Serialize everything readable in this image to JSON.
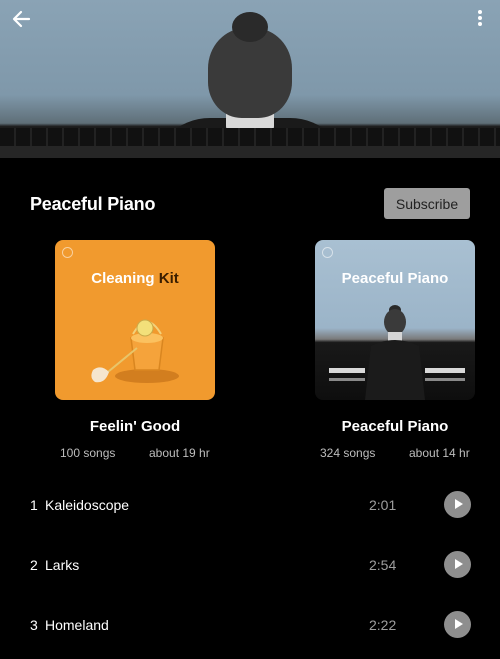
{
  "playlist": {
    "title": "Peaceful Piano",
    "subscribe_label": "Subscribe"
  },
  "icons": {
    "back": "back-arrow-icon",
    "more": "more-vertical-icon",
    "play": "play-icon",
    "spotify": "spotify-logo-icon"
  },
  "cards": [
    {
      "art_title_main": "Cleaning ",
      "art_title_bold": "Kit",
      "name": "Feelin' Good",
      "songs": "100 songs",
      "duration": "about 19 hr",
      "art_color": "#f19a2e"
    },
    {
      "art_title_main": "Peaceful Piano",
      "art_title_bold": "",
      "name": "Peaceful Piano",
      "songs": "324 songs",
      "duration": "about 14 hr",
      "art_color": "#a9c0d2"
    }
  ],
  "tracks": [
    {
      "number": "1",
      "title": "Kaleidoscope",
      "duration": "2:01"
    },
    {
      "number": "2",
      "title": "Larks",
      "duration": "2:54"
    },
    {
      "number": "3",
      "title": "Homeland",
      "duration": "2:22"
    }
  ]
}
